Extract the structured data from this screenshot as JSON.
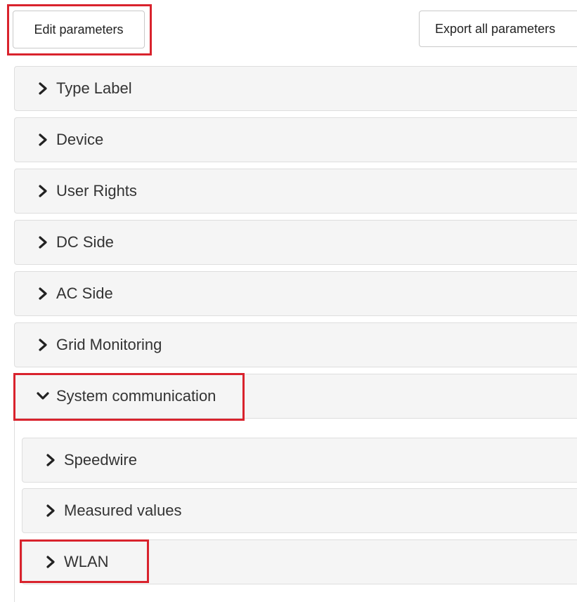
{
  "toolbar": {
    "edit_label": "Edit parameters",
    "export_label": "Export all parameters"
  },
  "groups": [
    {
      "label": "Type Label",
      "expanded": false,
      "icon": "chevron-right-icon"
    },
    {
      "label": "Device",
      "expanded": false,
      "icon": "chevron-right-icon"
    },
    {
      "label": "User Rights",
      "expanded": false,
      "icon": "chevron-right-icon"
    },
    {
      "label": "DC Side",
      "expanded": false,
      "icon": "chevron-right-icon"
    },
    {
      "label": "AC Side",
      "expanded": false,
      "icon": "chevron-right-icon"
    },
    {
      "label": "Grid Monitoring",
      "expanded": false,
      "icon": "chevron-right-icon"
    },
    {
      "label": "System communication",
      "expanded": true,
      "icon": "chevron-down-icon"
    }
  ],
  "subgroups": [
    {
      "label": "Speedwire",
      "expanded": false,
      "icon": "chevron-right-icon"
    },
    {
      "label": "Measured values",
      "expanded": false,
      "icon": "chevron-right-icon"
    },
    {
      "label": "WLAN",
      "expanded": false,
      "icon": "chevron-right-icon"
    }
  ],
  "colors": {
    "highlight": "#d9232d",
    "panel_background": "#f5f5f5",
    "panel_border": "#dedede"
  }
}
